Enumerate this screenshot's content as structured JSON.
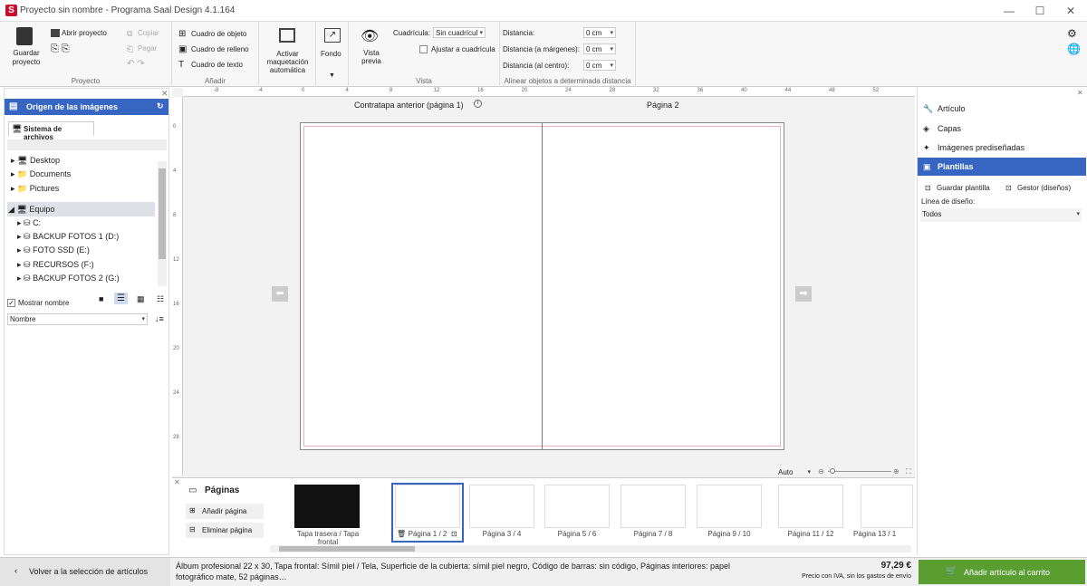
{
  "window": {
    "title": "Proyecto sin nombre - Programa Saal Design 4.1.164",
    "logo": "S"
  },
  "ribbon": {
    "proyecto": {
      "label": "Proyecto",
      "save": "Guardar proyecto",
      "open": "Abrir proyecto",
      "copy": "Copiar",
      "paste": "Pegar"
    },
    "anadir": {
      "label": "Añadir",
      "object_box": "Cuadro de objeto",
      "fill_box": "Cuadro de relleno",
      "text_box": "Cuadro de texto"
    },
    "auto_layout": "Activar maquetación automática",
    "fondo": "Fondo",
    "vista": {
      "label": "Vista",
      "preview": "Vista previa",
      "grid_label": "Cuadrícula:",
      "grid_value": "Sin cuadrícul",
      "snap": "Ajustar a cuadrícula"
    },
    "align": {
      "label": "Alinear objetos a determinada distancia",
      "dist": "Distancia:",
      "dist_margin": "Distancia (a márgenes):",
      "dist_center": "Distancia (al centro):",
      "v1": "0 cm",
      "v2": "0 cm",
      "v3": "0 cm"
    }
  },
  "left": {
    "header": "Origen de las imágenes",
    "tab": "Sistema de archivos",
    "tree": [
      "Desktop",
      "Documents",
      "Pictures",
      "Equipo",
      "C:",
      "BACKUP FOTOS 1 (D:)",
      "FOTO SSD (E:)",
      "RECURSOS (F:)",
      "BACKUP FOTOS 2 (G:)"
    ],
    "show_name": "Mostrar nombre",
    "sort": "Nombre"
  },
  "canvas": {
    "left_title": "Contratapa anterior (página 1)",
    "right_title": "Página 2",
    "zoom": "Auto",
    "hticks": [
      "-8",
      "-4",
      "0",
      "4",
      "8",
      "12",
      "16",
      "20",
      "24",
      "28",
      "32",
      "36",
      "40",
      "44",
      "48",
      "52"
    ],
    "vticks": [
      "0",
      "4",
      "8",
      "12",
      "16",
      "20",
      "24",
      "28"
    ]
  },
  "pages": {
    "title": "Páginas",
    "add": "Añadir página",
    "remove": "Eliminar página",
    "thumbs": [
      "Tapa trasera / Tapa frontal",
      "Página 1 / 2",
      "Página 3 / 4",
      "Página 5 / 6",
      "Página 7 / 8",
      "Página 9 / 10",
      "Página 11 / 12",
      "Página 13 / 1"
    ]
  },
  "right": {
    "items": [
      "Artículo",
      "Capas",
      "Imágenes prediseñadas",
      "Plantillas"
    ],
    "save_tpl": "Guardar plantilla",
    "manager": "Gestor (diseños)",
    "line_label": "Línea de diseño:",
    "line_value": "Todos"
  },
  "bottom": {
    "back": "Volver a la selección de artículos",
    "desc": "Álbum profesional 22 x 30, Tapa frontal: Símil piel / Tela, Superficie de la cubierta: símil piel negro, Código de barras: sin código, Páginas interiores: papel fotográfico mate, 52 páginas…",
    "price": "97,29 €",
    "price_note": "Precio con IVA, sin los gastos de envío",
    "cart": "Añadir artículo al carrito"
  },
  "colors": {
    "accent": "#3765c2",
    "cart": "#5a9e32",
    "logo": "#c8102e"
  }
}
